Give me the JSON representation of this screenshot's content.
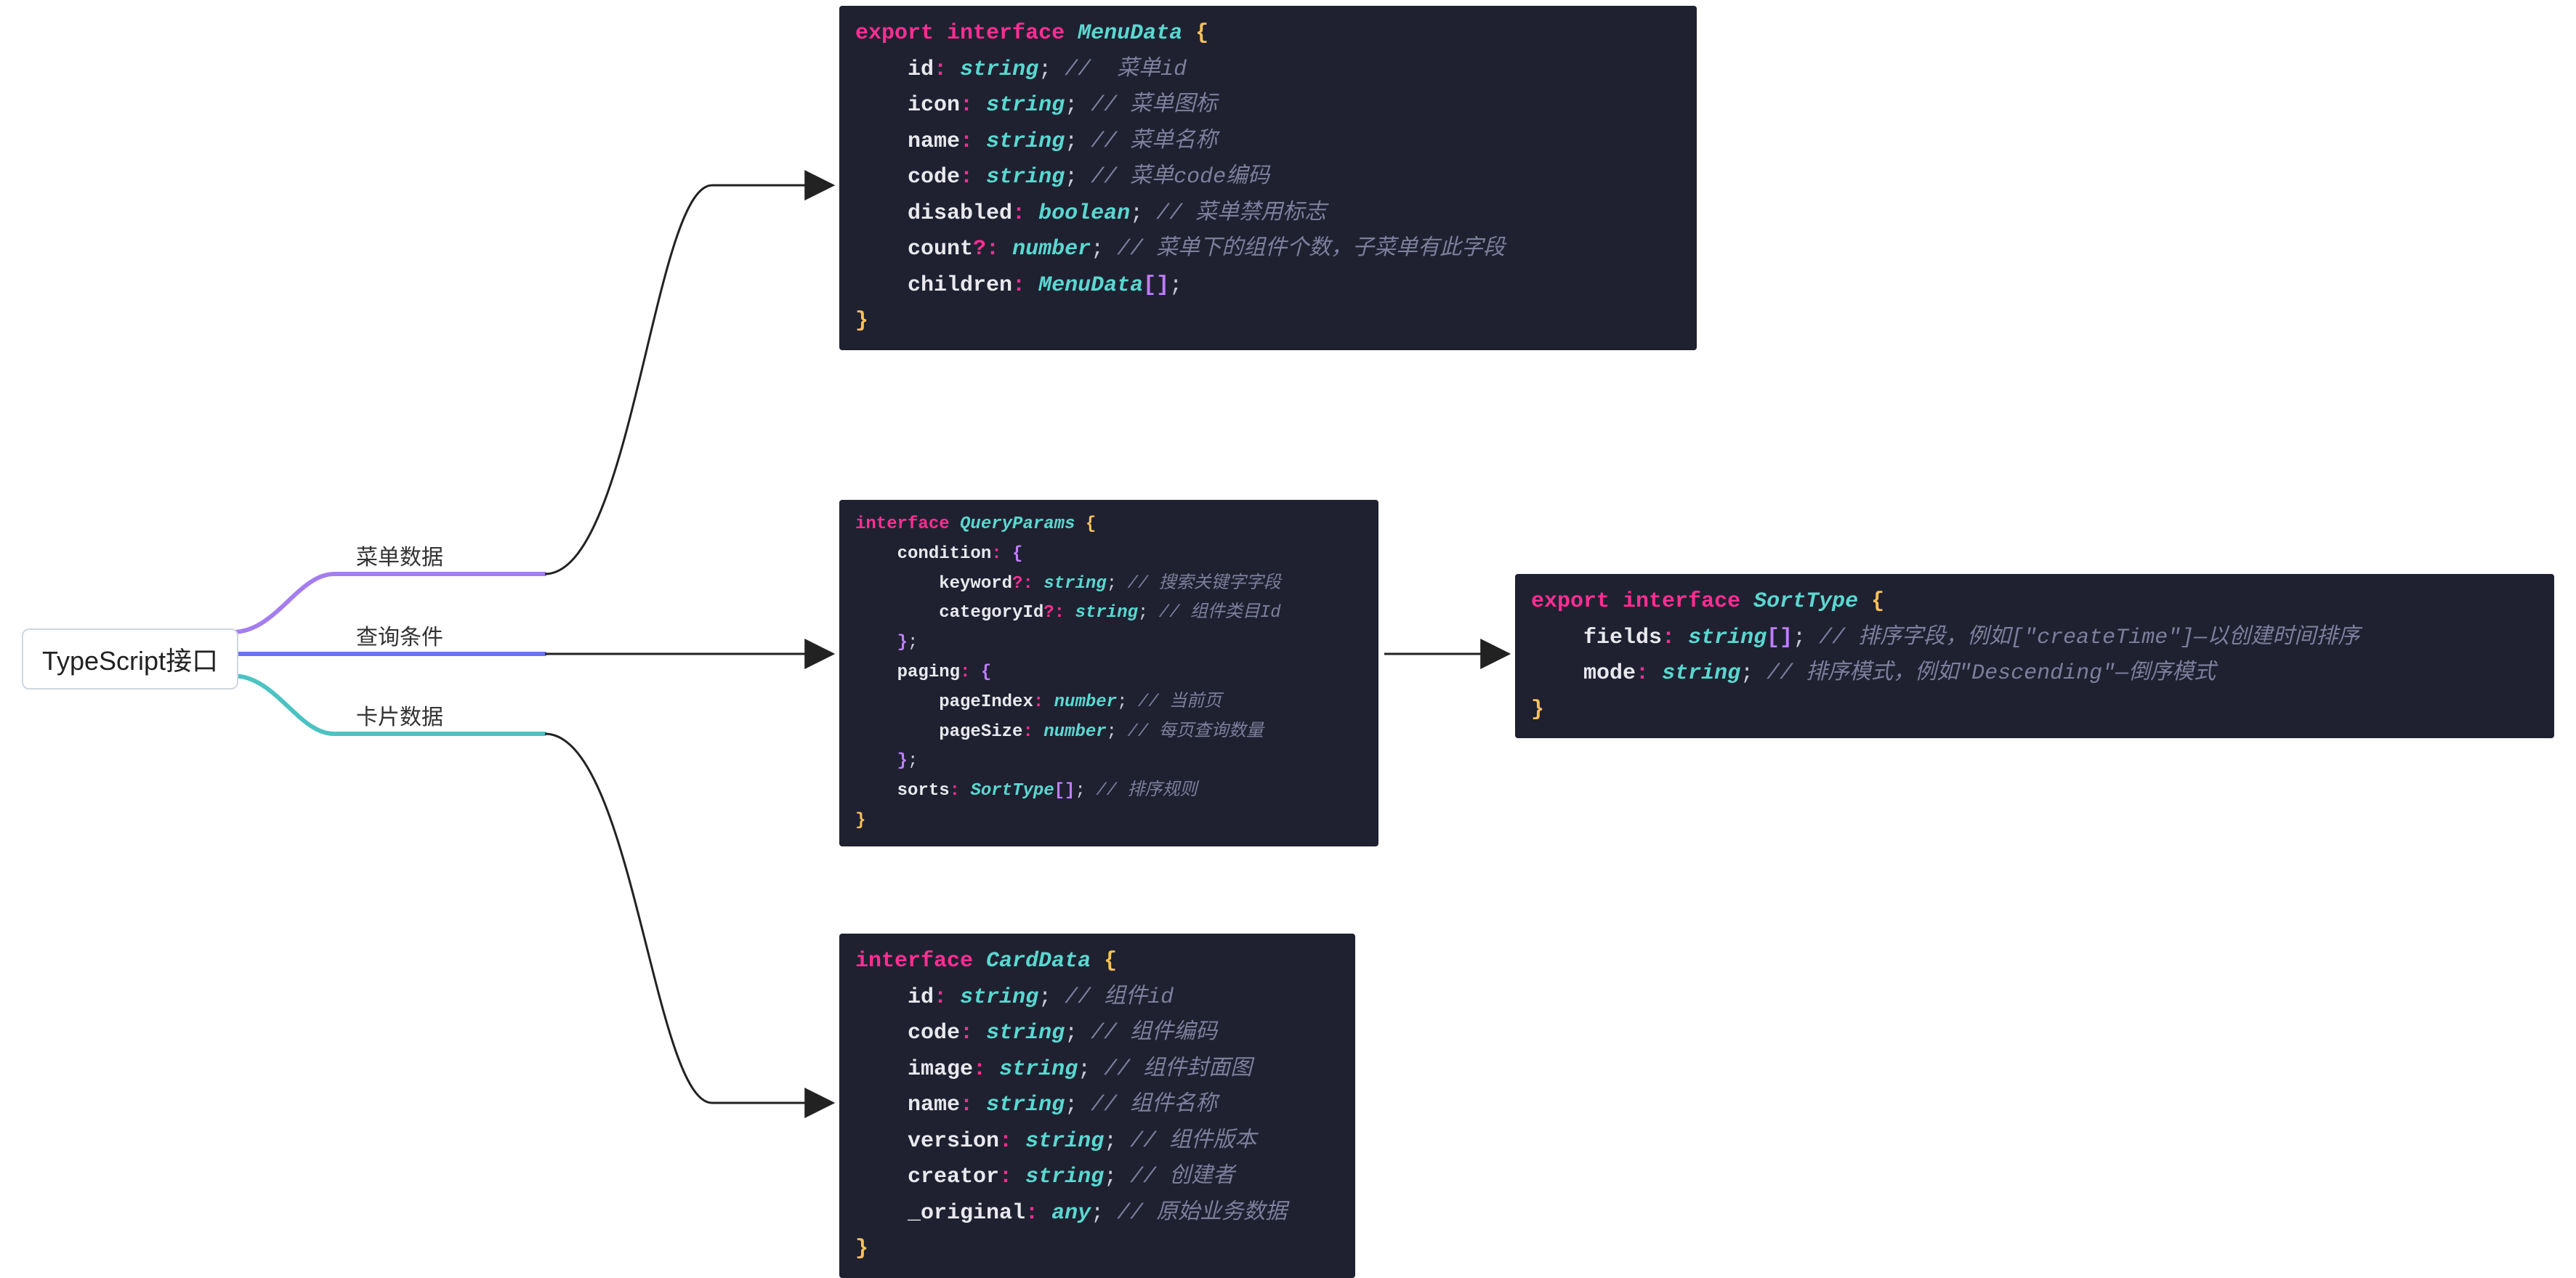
{
  "root": {
    "label": "TypeScript接口"
  },
  "branches": [
    {
      "id": "menu",
      "label": "菜单数据"
    },
    {
      "id": "query",
      "label": "查询条件"
    },
    {
      "id": "card",
      "label": "卡片数据"
    }
  ],
  "code": {
    "menuData": {
      "lines": {
        "l0_export": "export",
        "l0_interface": "interface",
        "l0_name": "MenuData",
        "id_field": "id",
        "id_type": "string",
        "id_comment": "//  菜单id",
        "icon_field": "icon",
        "icon_type": "string",
        "icon_comment": "// 菜单图标",
        "name_field": "name",
        "name_type": "string",
        "name_comment": "// 菜单名称",
        "code_field": "code",
        "code_type": "string",
        "code_comment": "// 菜单code编码",
        "disabled_field": "disabled",
        "disabled_type": "boolean",
        "disabled_comment": "// 菜单禁用标志",
        "count_field": "count",
        "count_type": "number",
        "count_comment": "// 菜单下的组件个数，子菜单有此字段",
        "children_field": "children",
        "children_type": "MenuData"
      }
    },
    "queryParams": {
      "lines": {
        "l0_interface": "interface",
        "l0_name": "QueryParams",
        "condition_field": "condition",
        "keyword_field": "keyword",
        "keyword_type": "string",
        "keyword_comment": "// 搜索关键字字段",
        "categoryId_field": "categoryId",
        "categoryId_type": "string",
        "categoryId_comment": "// 组件类目Id",
        "paging_field": "paging",
        "pageIndex_field": "pageIndex",
        "pageIndex_type": "number",
        "pageIndex_comment": "// 当前页",
        "pageSize_field": "pageSize",
        "pageSize_type": "number",
        "pageSize_comment": "// 每页查询数量",
        "sorts_field": "sorts",
        "sorts_type": "SortType",
        "sorts_comment": "// 排序规则"
      }
    },
    "cardData": {
      "lines": {
        "l0_interface": "interface",
        "l0_name": "CardData",
        "id_field": "id",
        "id_type": "string",
        "id_comment": "// 组件id",
        "codef_field": "code",
        "codef_type": "string",
        "codef_comment": "// 组件编码",
        "image_field": "image",
        "image_type": "string",
        "image_comment": "// 组件封面图",
        "name_field": "name",
        "name_type": "string",
        "name_comment": "// 组件名称",
        "version_field": "version",
        "version_type": "string",
        "version_comment": "// 组件版本",
        "creator_field": "creator",
        "creator_type": "string",
        "creator_comment": "// 创建者",
        "orig_field": "_original",
        "orig_type": "any",
        "orig_comment": "// 原始业务数据"
      }
    },
    "sortType": {
      "lines": {
        "l0_export": "export",
        "l0_interface": "interface",
        "l0_name": "SortType",
        "fields_field": "fields",
        "fields_type": "string",
        "fields_comment": "// 排序字段，例如[\"createTime\"]—以创建时间排序",
        "mode_field": "mode",
        "mode_type": "string",
        "mode_comment": "// 排序模式，例如\"Descending\"—倒序模式"
      }
    }
  },
  "colors": {
    "branch_menu": "#a47df0",
    "branch_query": "#6d73f0",
    "branch_card": "#4cc2c2",
    "connector": "#222222",
    "arrow": "#222222"
  }
}
